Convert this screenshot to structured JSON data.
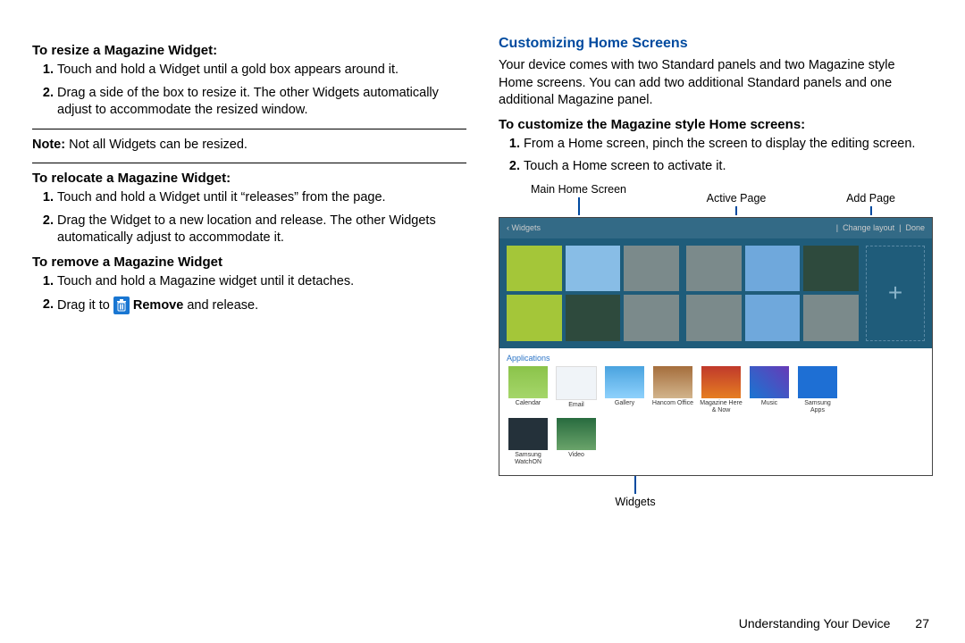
{
  "leftColumn": {
    "resizeHeading": "To resize a Magazine Widget:",
    "resizeSteps": [
      "Touch and hold a Widget until a gold box appears around it.",
      "Drag a side of the box to resize it. The other Widgets automatically adjust to accommodate the resized window."
    ],
    "noteLabel": "Note:",
    "noteText": " Not all Widgets can be resized.",
    "relocateHeading": "To relocate a Magazine Widget:",
    "relocateSteps": [
      "Touch and hold a Widget until it “releases” from the page.",
      "Drag the Widget to a new location and release. The other Widgets automatically adjust to accommodate it."
    ],
    "removeHeading": "To remove a Magazine Widget",
    "removeStep1": "Touch and hold a Magazine widget until it detaches.",
    "removeStep2a": "Drag it to ",
    "removeLabel": "Remove",
    "removeStep2b": " and release."
  },
  "rightColumn": {
    "headingBlue": "Customizing Home Screens",
    "intro": "Your device comes with two Standard panels and two Magazine style Home screens. You can add two additional Standard panels and one additional Magazine panel.",
    "customizeHeading": "To customize the Magazine style Home screens:",
    "customizeSteps": [
      "From a Home screen, pinch the screen to display the editing screen.",
      "Touch a Home screen to activate it."
    ],
    "callouts": {
      "main": "Main Home Screen",
      "active": "Active Page",
      "add": "Add Page",
      "widgets": "Widgets"
    },
    "shot": {
      "back": "‹  Widgets",
      "change": "Change layout",
      "done": "Done",
      "applications": "Applications",
      "apps": [
        {
          "label": "Calendar",
          "cls": "green"
        },
        {
          "label": "Email",
          "cls": "white"
        },
        {
          "label": "Gallery",
          "cls": "blue"
        },
        {
          "label": "Hancom Office",
          "cls": "brown"
        },
        {
          "label": "Magazine Here\\n& Now",
          "cls": "red"
        },
        {
          "label": "Music",
          "cls": "grad"
        },
        {
          "label": "Samsung\\nApps",
          "cls": "bluesq"
        },
        {
          "label": "Samsung\\nWatchON",
          "cls": "dark"
        },
        {
          "label": "Video",
          "cls": "photo"
        }
      ]
    }
  },
  "footer": {
    "section": "Understanding Your Device",
    "page": "27"
  }
}
